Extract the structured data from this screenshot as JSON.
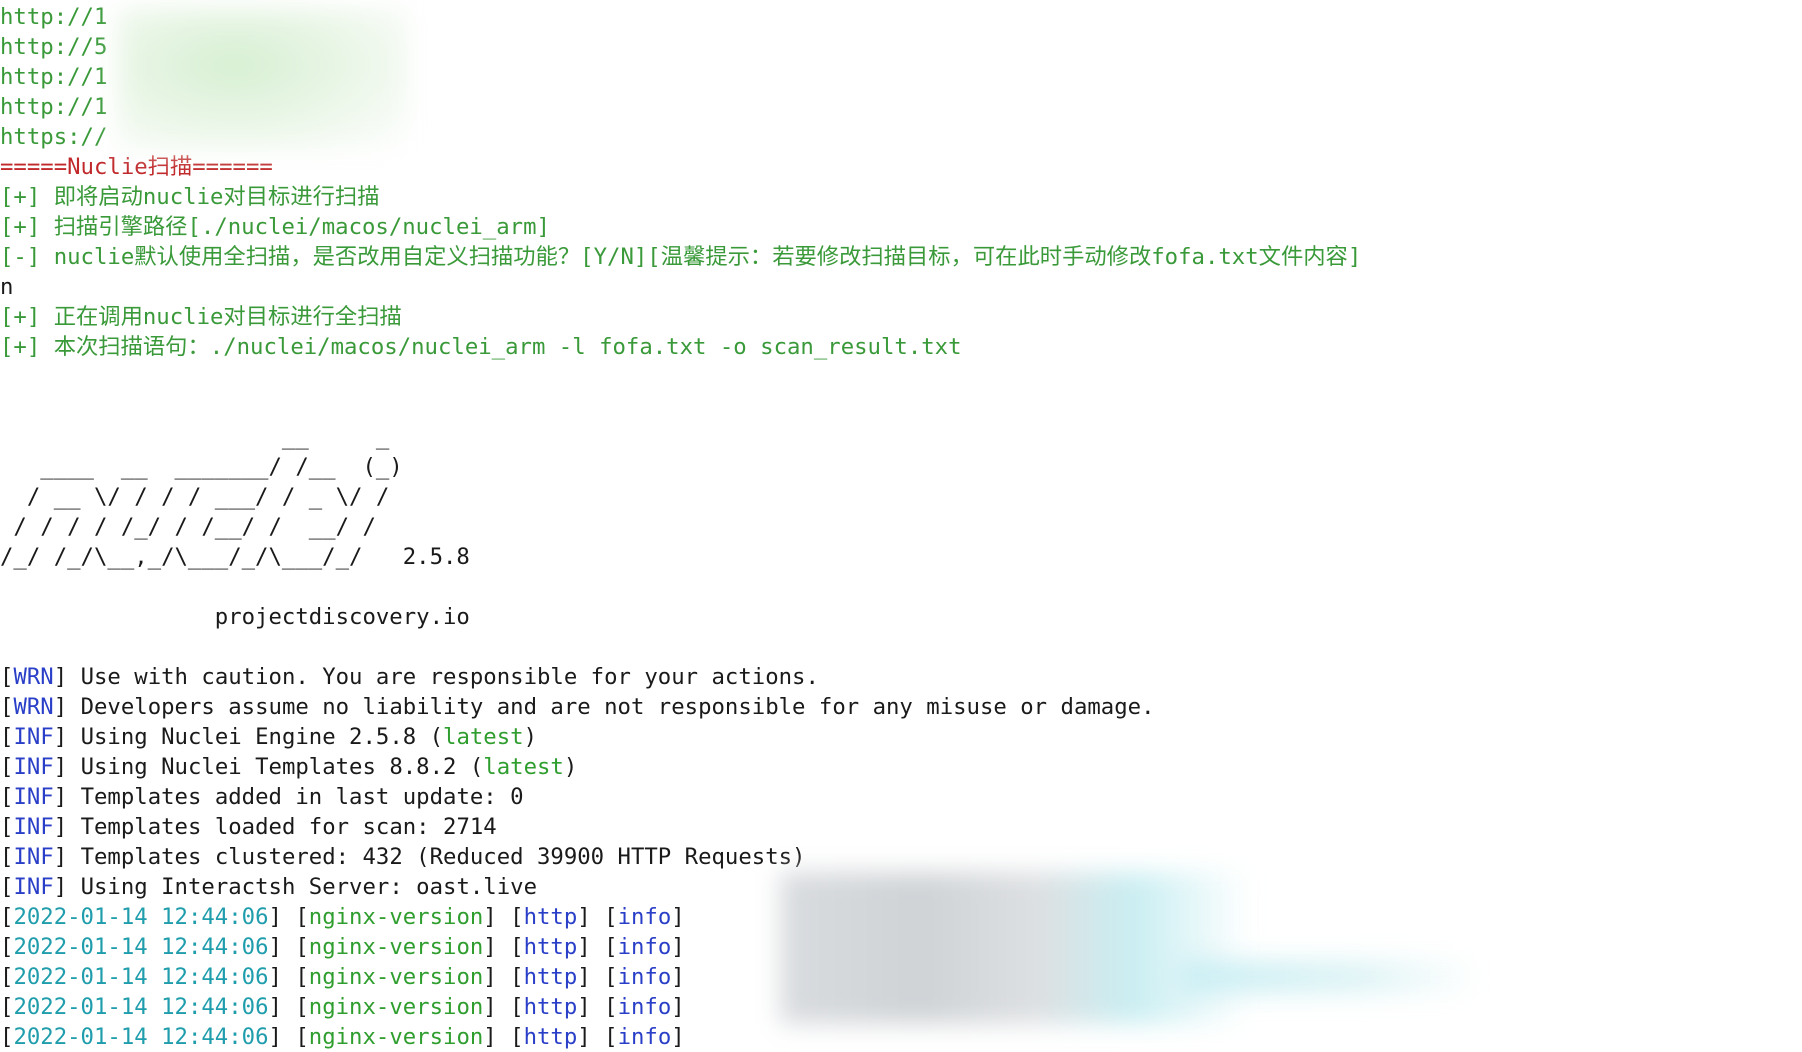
{
  "url_lines": [
    {
      "prefix": "http://1"
    },
    {
      "prefix": "http://5"
    },
    {
      "prefix": "http://1"
    },
    {
      "prefix": "http://1"
    },
    {
      "prefix": "https://"
    }
  ],
  "section_header": "=====Nuclie扫描======",
  "status_lines": [
    "[+] 即将启动nuclie对目标进行扫描",
    "[+] 扫描引擎路径[./nuclei/macos/nuclei_arm]",
    "[-] nuclie默认使用全扫描，是否改用自定义扫描功能？[Y/N][温馨提示：若要修改扫描目标，可在此时手动修改fofa.txt文件内容]"
  ],
  "user_input": "n",
  "status_lines_2": [
    "[+] 正在调用nuclie对目标进行全扫描",
    "[+] 本次扫描语句：./nuclei/macos/nuclei_arm -l fofa.txt -o scan_result.txt"
  ],
  "banner": [
    "                     __     _",
    "   ____  __  _______/ /__  (_)",
    "  / __ \\/ / / / ___/ / _ \\/ /",
    " / / / / /_/ / /__/ /  __/ /",
    "/_/ /_/\\__,_/\\___/_/\\___/_/   2.5.8",
    "",
    "                projectdiscovery.io"
  ],
  "log_lines": [
    {
      "tag": "WRN",
      "text": " Use with caution. You are responsible for your actions."
    },
    {
      "tag": "WRN",
      "text": " Developers assume no liability and are not responsible for any misuse or damage."
    },
    {
      "tag": "INF",
      "text": " Using Nuclei Engine 2.5.8 (",
      "highlight": "latest",
      "suffix": ")"
    },
    {
      "tag": "INF",
      "text": " Using Nuclei Templates 8.8.2 (",
      "highlight": "latest",
      "suffix": ")"
    },
    {
      "tag": "INF",
      "text": " Templates added in last update: 0"
    },
    {
      "tag": "INF",
      "text": " Templates loaded for scan: 2714"
    },
    {
      "tag": "INF",
      "text": " Templates clustered: 432 (Reduced 39900 HTTP Requests)"
    },
    {
      "tag": "INF",
      "text": " Using Interactsh Server: oast.live"
    }
  ],
  "results": [
    {
      "time": "2022-01-14 12:44:06",
      "template": "nginx-version",
      "protocol": "http",
      "severity": "info"
    },
    {
      "time": "2022-01-14 12:44:06",
      "template": "nginx-version",
      "protocol": "http",
      "severity": "info"
    },
    {
      "time": "2022-01-14 12:44:06",
      "template": "nginx-version",
      "protocol": "http",
      "severity": "info"
    },
    {
      "time": "2022-01-14 12:44:06",
      "template": "nginx-version",
      "protocol": "http",
      "severity": "info"
    },
    {
      "time": "2022-01-14 12:44:06",
      "template": "nginx-version",
      "protocol": "http",
      "severity": "info"
    }
  ],
  "colors": {
    "green": "#3a9a3a",
    "red": "#c0282a",
    "blue": "#2a3fc8",
    "cyan": "#1f9dac"
  }
}
